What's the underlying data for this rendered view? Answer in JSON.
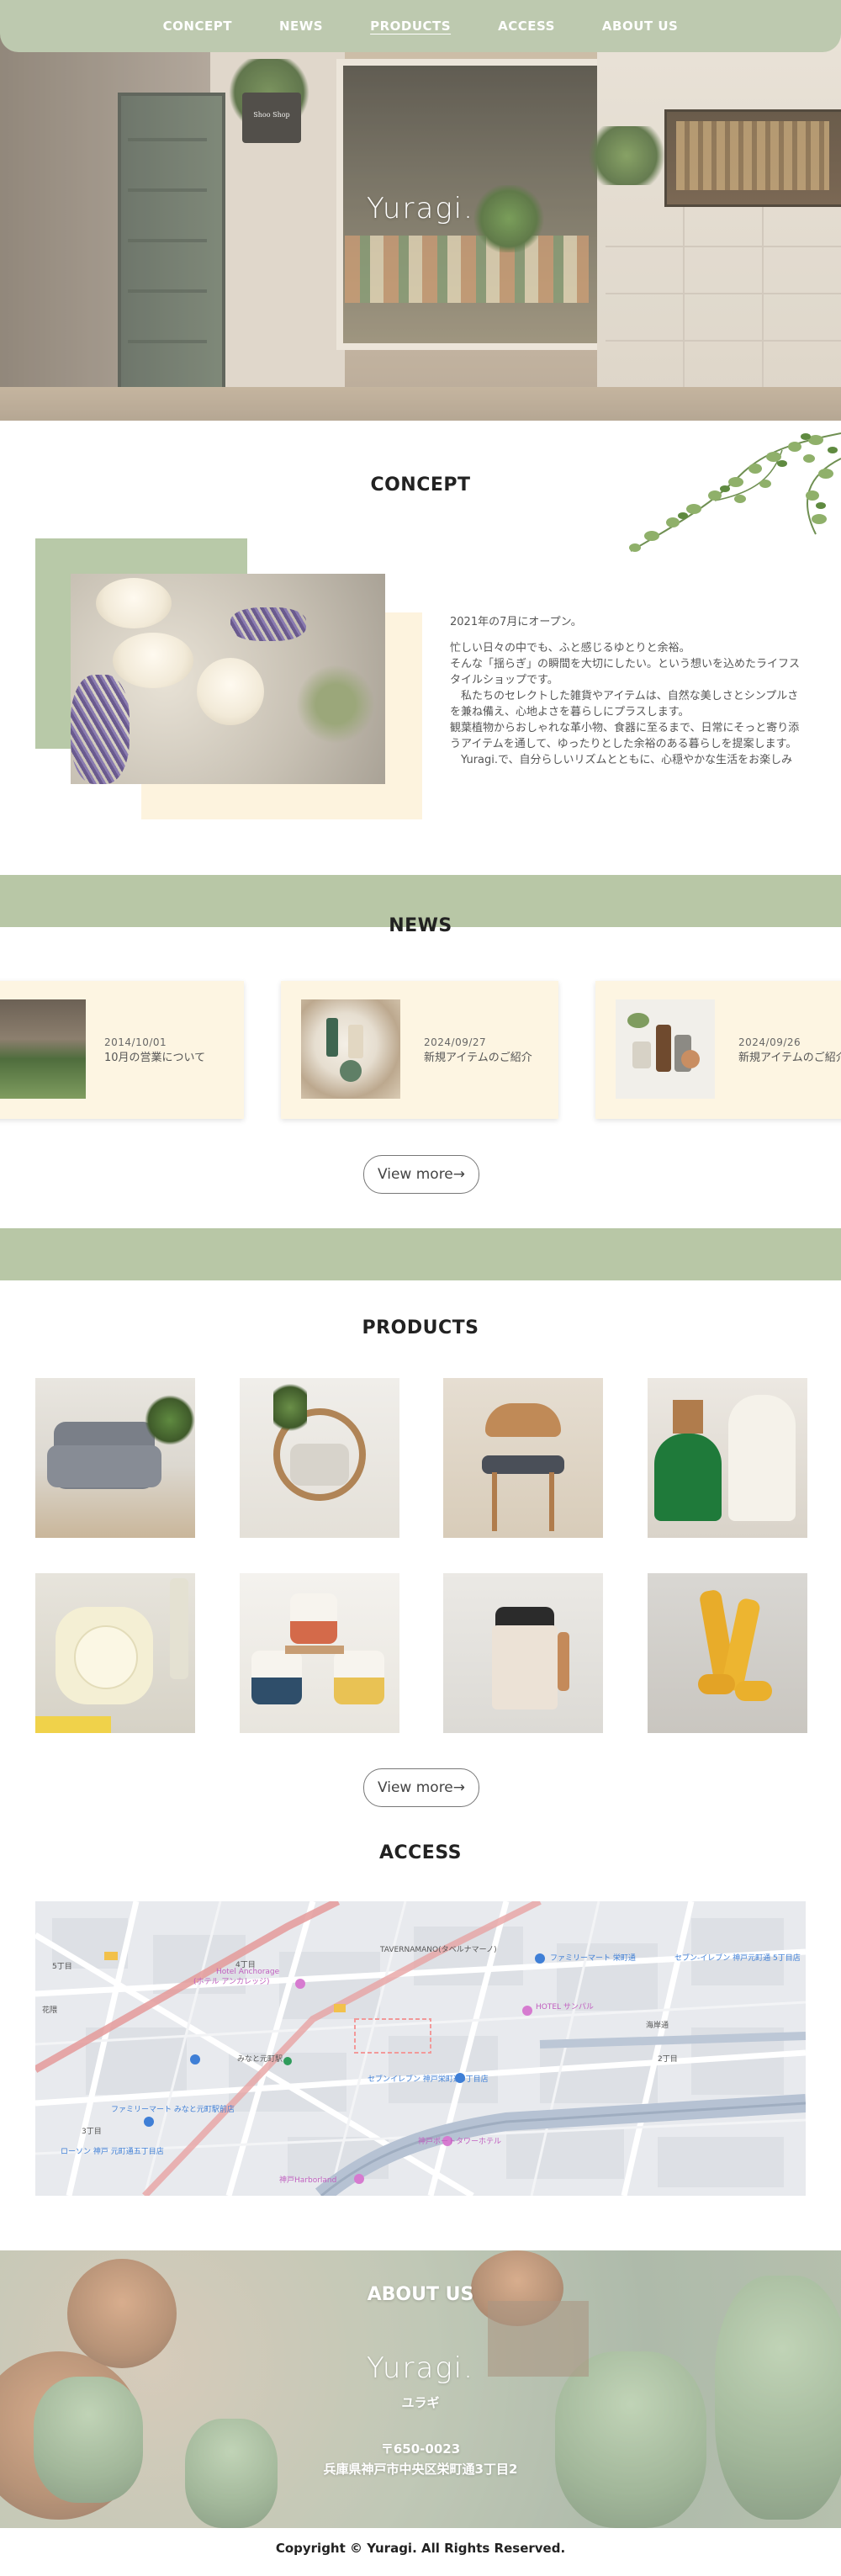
{
  "nav": {
    "items": [
      {
        "label": "CONCEPT"
      },
      {
        "label": "NEWS"
      },
      {
        "label": "PRODUCTS",
        "active": true
      },
      {
        "label": "ACCESS"
      },
      {
        "label": "ABOUT US"
      }
    ]
  },
  "hero": {
    "logo": "Yuragi.",
    "shop_sign": "Shoo Shop"
  },
  "concept": {
    "title": "CONCEPT",
    "paragraphs": [
      "2021年の7月にオープン。",
      "忙しい日々の中でも、ふと感じるゆとりと余裕。",
      "そんな「揺らぎ」の瞬間を大切にしたい。という想いを込めたライフスタイルショップです。",
      "　私たちのセレクトした雑貨やアイテムは、自然な美しさとシンプルさを兼ね備え、心地よさを暮らしにプラスします。",
      "観葉植物からおしゃれな革小物、食器に至るまで、日常にそっと寄り添うアイテムを通して、ゆったりとした余裕のある暮らしを提案します。",
      "　Yuragi.で、自分らしいリズムとともに、心穏やかな生活をお楽しみ"
    ]
  },
  "news": {
    "title": "NEWS",
    "items": [
      {
        "date": "2014/10/01",
        "text": "10月の営業について"
      },
      {
        "date": "2024/09/27",
        "text": "新規アイテムのご紹介"
      },
      {
        "date": "2024/09/26",
        "text": "新規アイテムのご紹介"
      }
    ],
    "more_label": "View more→"
  },
  "products": {
    "title": "PRODUCTS",
    "more_label": "View more→"
  },
  "access": {
    "title": "ACCESS",
    "map_labels": [
      "TAVERNAMANO(タベルナマーノ)",
      "Hotel Anchorage",
      "(ホテル アンカレッジ)",
      "ファミリーマート 栄町通",
      "セブン-イレブン 神戸元町通 5丁目店",
      "HOTEL サンパル",
      "みなと元町駅",
      "セブンイレブン 神戸栄町通3丁目店",
      "ファミリーマート みなと元町駅前店",
      "ローソン 神戸 元町通五丁目店",
      "神戸ポートタワーホテル",
      "神戸Harborland",
      "海岸通",
      "花隈",
      "4丁目",
      "3丁目",
      "2丁目",
      "5丁目"
    ]
  },
  "about": {
    "title": "ABOUT US",
    "logo": "Yuragi.",
    "kana": "ユラギ",
    "zip": "〒650-0023",
    "address": "兵庫県神戸市中央区栄町通3丁目2"
  },
  "footer": {
    "copyright": "Copyright © Yuragi. All Rights Reserved."
  },
  "colors": {
    "sage": "#b8c7a6",
    "cream": "#fdf5e2",
    "nav": "#bdc9af"
  }
}
